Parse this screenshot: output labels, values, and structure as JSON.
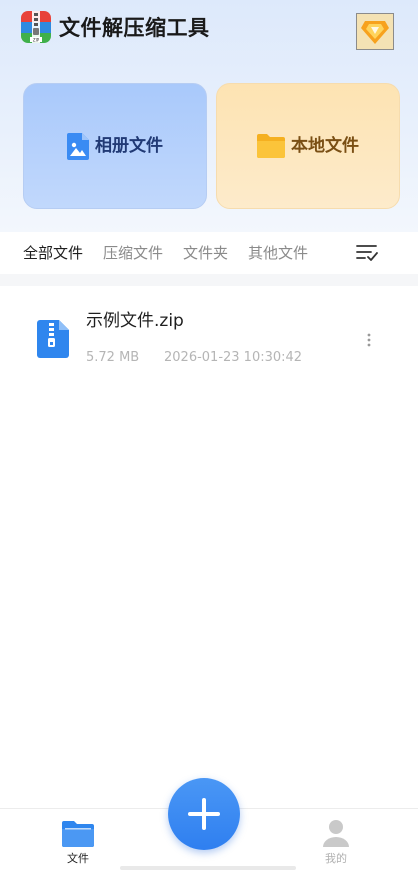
{
  "header": {
    "title": "文件解压缩工具",
    "logo_icon": "zip-archive-logo",
    "vip_icon": "diamond-icon"
  },
  "cards": {
    "album": {
      "label": "相册文件",
      "icon": "image-file-icon",
      "color": "#a9c9fb"
    },
    "local": {
      "label": "本地文件",
      "icon": "folder-icon",
      "color": "#fde3b2"
    }
  },
  "tabs": [
    {
      "label": "全部文件",
      "active": true
    },
    {
      "label": "压缩文件",
      "active": false
    },
    {
      "label": "文件夹",
      "active": false
    },
    {
      "label": "其他文件",
      "active": false
    }
  ],
  "sort_icon": "sort-check-icon",
  "files": [
    {
      "name": "示例文件.zip",
      "size": "5.72 MB",
      "date": "2026-01-23 10:30:42",
      "icon": "zip-file-icon"
    }
  ],
  "bottom_nav": {
    "files_label": "文件",
    "mine_label": "我的",
    "fab_icon": "plus-icon"
  },
  "colors": {
    "accent": "#3a8bf3",
    "folder": "#f5b020",
    "muted_text": "#b5b5b5"
  }
}
